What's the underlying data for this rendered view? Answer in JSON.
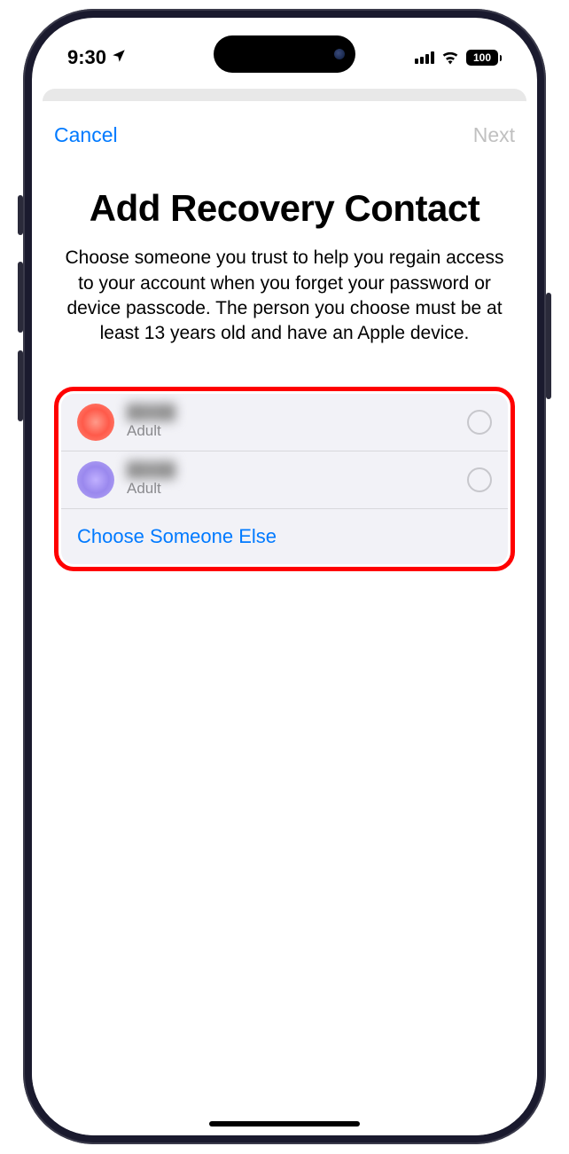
{
  "status": {
    "time": "9:30",
    "battery": "100"
  },
  "nav": {
    "cancel": "Cancel",
    "next": "Next"
  },
  "header": {
    "title": "Add Recovery Contact",
    "description": "Choose someone you trust to help you regain access to your account when you forget your password or device passcode. The person you choose must be at least 13 years old and have an Apple device."
  },
  "contacts": [
    {
      "role": "Adult",
      "avatar_color": "red"
    },
    {
      "role": "Adult",
      "avatar_color": "purple"
    }
  ],
  "choose_else": "Choose Someone Else"
}
